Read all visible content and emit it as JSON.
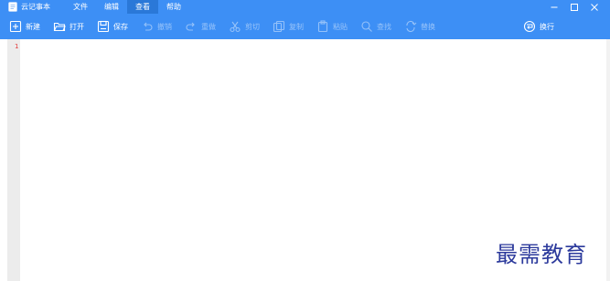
{
  "app": {
    "title": "云记事本"
  },
  "menu": {
    "items": [
      "文件",
      "编辑",
      "查看",
      "帮助"
    ],
    "active_index": 2
  },
  "toolbar": {
    "new_label": "新建",
    "open_label": "打开",
    "save_label": "保存",
    "undo_label": "撤销",
    "redo_label": "重做",
    "cut_label": "剪切",
    "copy_label": "复制",
    "paste_label": "粘贴",
    "find_label": "查找",
    "replace_label": "替换",
    "wrap_label": "换行"
  },
  "editor": {
    "line_number": "1",
    "line_number_color": "#e23b3b"
  },
  "watermark": "最需教育",
  "colors": {
    "accent": "#3d8ff5",
    "active_menu": "#2a78d8",
    "gutter": "#ececec"
  },
  "icons": [
    "notepad-icon",
    "minimize-icon",
    "maximize-icon",
    "close-icon",
    "new-file-icon",
    "open-folder-icon",
    "save-icon",
    "undo-icon",
    "redo-icon",
    "cut-icon",
    "copy-icon",
    "paste-icon",
    "find-icon",
    "replace-icon",
    "wrap-icon"
  ]
}
